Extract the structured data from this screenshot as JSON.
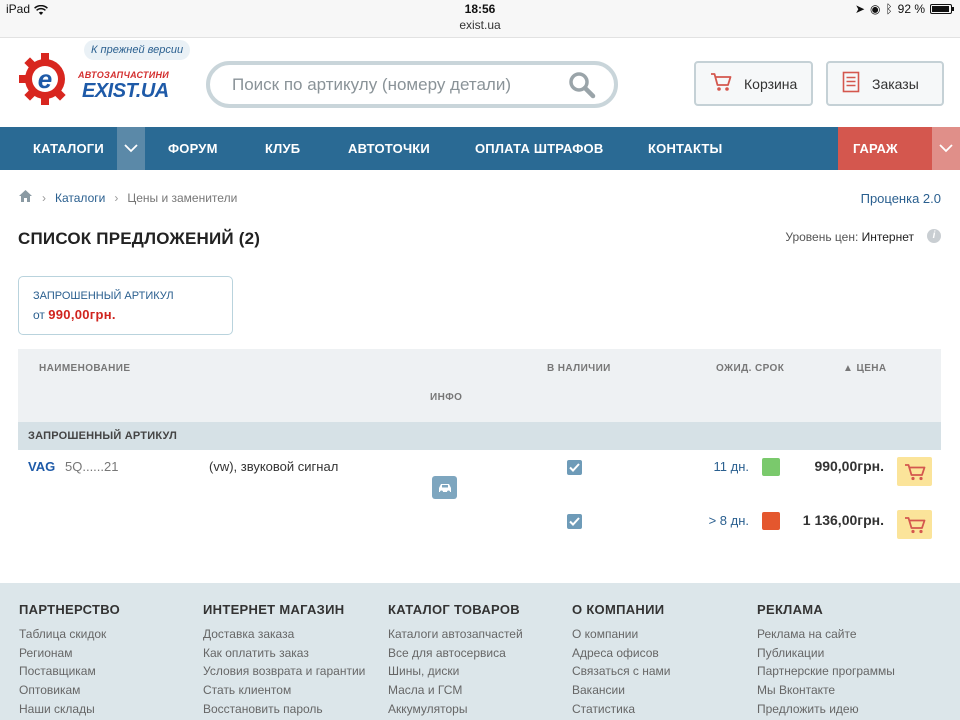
{
  "status_bar": {
    "device": "iPad",
    "time": "18:56",
    "url": "exist.ua",
    "battery": "92 %",
    "battery_level": 0.92
  },
  "logo": {
    "subtitle": "АВТОЗАПЧАСТИНИ",
    "name": "EXIST.UA"
  },
  "prev_version": "К прежней версии",
  "search": {
    "placeholder": "Поиск по артикулу (номеру детали)"
  },
  "header_buttons": {
    "cart": "Корзина",
    "orders": "Заказы"
  },
  "nav": {
    "items": [
      "КАТАЛОГИ",
      "ФОРУМ",
      "КЛУБ",
      "АВТОТОЧКИ",
      "ОПЛАТА ШТРАФОВ",
      "КОНТАКТЫ"
    ],
    "garage": "ГАРАЖ"
  },
  "breadcrumb": {
    "items": [
      "Каталоги",
      "Цены и заменители"
    ]
  },
  "estimate_link": "Проценка 2.0",
  "page_title": "СПИСОК ПРЕДЛОЖЕНИЙ (2)",
  "price_level": {
    "label": "Уровень цен:",
    "value": "Интернет"
  },
  "requested": {
    "title": "ЗАПРОШЕННЫЙ АРТИКУЛ",
    "prefix": "от",
    "price": "990,00грн."
  },
  "table": {
    "headers": {
      "name": "НАИМЕНОВАНИЕ",
      "info": "ИНФО",
      "stock": "В НАЛИЧИИ",
      "term": "ОЖИД. СРОК",
      "price": "ЦЕНА"
    },
    "group_label": "ЗАПРОШЕННЫЙ АРТИКУЛ",
    "item": {
      "brand": "VAG",
      "article": "5Q......21",
      "description": "(vw), звуковой сигнал"
    },
    "offers": [
      {
        "in_stock": true,
        "term": "11 дн.",
        "term_color": "#7ac96c",
        "price": "990,00грн."
      },
      {
        "in_stock": true,
        "term": "> 8 дн.",
        "term_color": "#e4572e",
        "price": "1 136,00грн."
      }
    ]
  },
  "footer": {
    "columns": [
      {
        "title": "ПАРТНЕРСТВО",
        "links": [
          "Таблица скидок",
          "Регионам",
          "Поставщикам",
          "Оптовикам",
          "Наши склады"
        ]
      },
      {
        "title": "ИНТЕРНЕТ МАГАЗИН",
        "links": [
          "Доставка заказа",
          "Как оплатить заказ",
          "Условия возврата и гарантии",
          "Стать клиентом",
          "Восстановить пароль"
        ]
      },
      {
        "title": "КАТАЛОГ ТОВАРОВ",
        "links": [
          "Каталоги автозапчастей",
          "Все для автосервиса",
          "Шины, диски",
          "Масла и ГСМ",
          "Аккумуляторы"
        ]
      },
      {
        "title": "О КОМПАНИИ",
        "links": [
          "О компании",
          "Адреса офисов",
          "Связаться с нами",
          "Вакансии",
          "Статистика"
        ]
      },
      {
        "title": "РЕКЛАМА",
        "links": [
          "Реклама на сайте",
          "Публикации",
          "Партнерские программы",
          "Мы Вконтакте",
          "Предложить идею"
        ]
      }
    ]
  }
}
